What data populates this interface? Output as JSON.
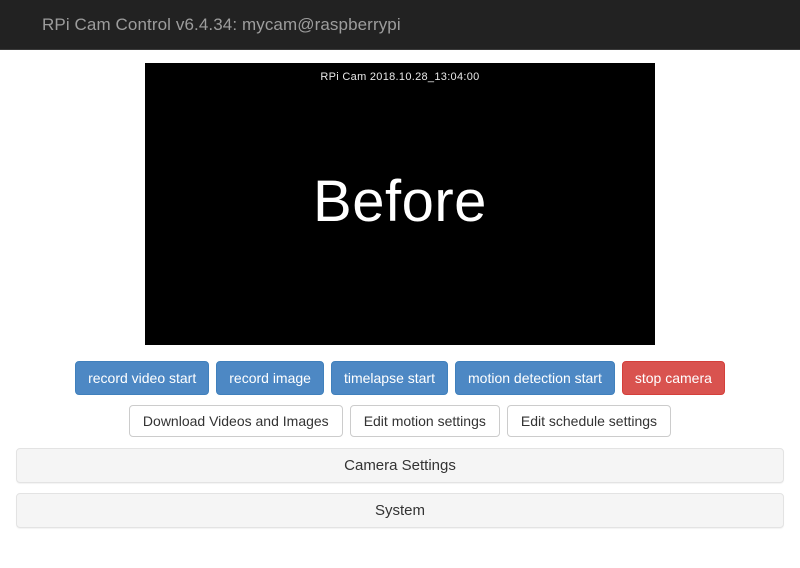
{
  "header": {
    "brand": "RPi Cam Control v6.4.34: mycam@raspberrypi"
  },
  "preview": {
    "timestamp_overlay": "RPi Cam  2018.10.28_13:04:00",
    "caption": "Before"
  },
  "primary_buttons": [
    {
      "label": "record video start",
      "style": "primary"
    },
    {
      "label": "record image",
      "style": "primary"
    },
    {
      "label": "timelapse start",
      "style": "primary"
    },
    {
      "label": "motion detection start",
      "style": "primary"
    },
    {
      "label": "stop camera",
      "style": "danger"
    }
  ],
  "secondary_buttons": [
    {
      "label": "Download Videos and Images"
    },
    {
      "label": "Edit motion settings"
    },
    {
      "label": "Edit schedule settings"
    }
  ],
  "panels": [
    {
      "title": "Camera Settings"
    },
    {
      "title": "System"
    }
  ],
  "colors": {
    "navbar_bg": "#222222",
    "navbar_text": "#9d9d9d",
    "primary_btn": "#4d88c4",
    "danger_btn": "#d9534f",
    "panel_bg": "#f5f5f5",
    "panel_border": "#e3e3e3",
    "preview_bg": "#000000"
  }
}
